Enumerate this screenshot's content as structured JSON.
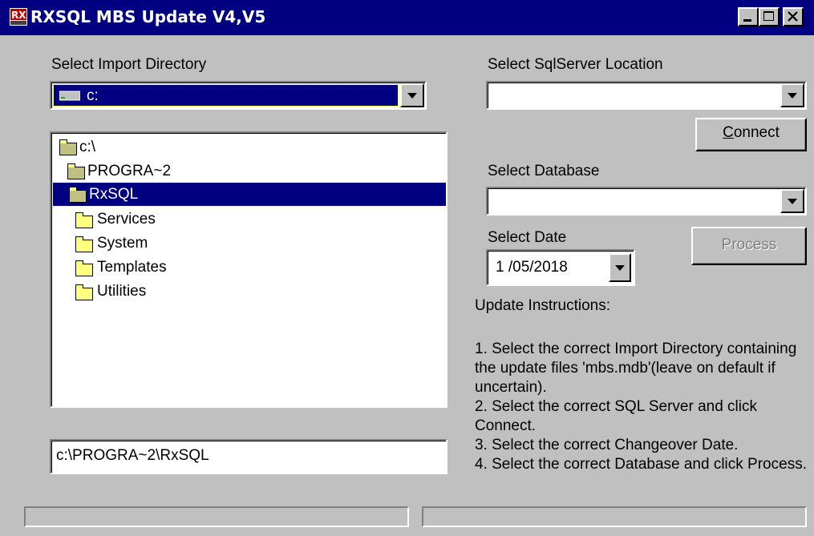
{
  "window": {
    "title": "RXSQL MBS Update V4,V5",
    "icon": "rx-app-icon",
    "controls": [
      "minimize-icon",
      "maximize-icon",
      "close-icon"
    ]
  },
  "import_dir": {
    "label": "Select Import Directory",
    "drive_value": "c:",
    "tree": [
      {
        "label": "c:\\",
        "depth": 0,
        "open": true,
        "selected": false
      },
      {
        "label": "PROGRA~2",
        "depth": 1,
        "open": true,
        "selected": false
      },
      {
        "label": "RxSQL",
        "depth": 2,
        "open": true,
        "selected": true
      },
      {
        "label": "Services",
        "depth": 3,
        "open": false,
        "selected": false
      },
      {
        "label": "System",
        "depth": 3,
        "open": false,
        "selected": false
      },
      {
        "label": "Templates",
        "depth": 3,
        "open": false,
        "selected": false
      },
      {
        "label": "Utilities",
        "depth": 3,
        "open": false,
        "selected": false
      }
    ],
    "path_value": "c:\\PROGRA~2\\RxSQL"
  },
  "sql": {
    "location_label": "Select SqlServer Location",
    "location_value": "",
    "connect_label": "Connect",
    "database_label": "Select Database",
    "database_value": "",
    "date_label": "Select Date",
    "date_value": "1 /05/2018",
    "process_label": "Process"
  },
  "instructions": {
    "heading": "Update Instructions:",
    "steps": [
      "1. Select the correct Import Directory containing the update files 'mbs.mdb'(leave on default if uncertain).",
      "2. Select the correct SQL Server and click Connect.",
      "3. Select the correct Changeover Date.",
      "4. Select the correct Database and click Process."
    ]
  },
  "colors": {
    "titlebar": "#000080",
    "selection": "#000080",
    "face": "#c0c0c0"
  }
}
